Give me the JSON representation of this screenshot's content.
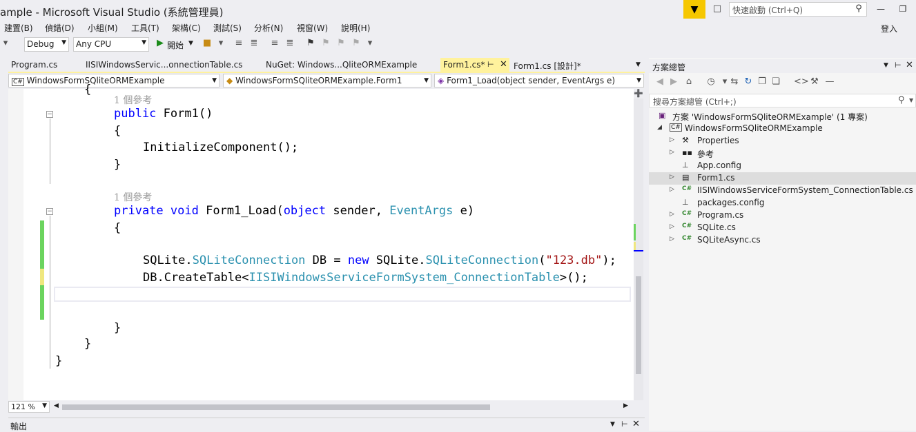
{
  "window": {
    "title": "ample - Microsoft Visual Studio (系統管理員)",
    "quick_launch_placeholder": "快速啟動 (Ctrl+Q)",
    "sign_in": "登入"
  },
  "menu": [
    "建置(B)",
    "偵錯(D)",
    "小組(M)",
    "工具(T)",
    "架構(C)",
    "測試(S)",
    "分析(N)",
    "視窗(W)",
    "說明(H)"
  ],
  "toolbar": {
    "config": "Debug",
    "platform": "Any CPU",
    "start_label": "開始"
  },
  "tabs": [
    {
      "label": "Program.cs"
    },
    {
      "label": "IISIWindowsServic...onnectionTable.cs"
    },
    {
      "label": "NuGet: Windows...QliteORMExample"
    },
    {
      "label": "Form1.cs*"
    },
    {
      "label": "Form1.cs [設計]*"
    }
  ],
  "navbar": {
    "project": "WindowsFormSQliteORMExample",
    "class": "WindowsFormSQliteORMExample.Form1",
    "member": "Form1_Load(object sender, EventArgs e)"
  },
  "code": {
    "brace_top": "{",
    "lens1": "1 個參考",
    "l1_kw": "public",
    "l1_rest": " Form1()",
    "l2": "{",
    "l3": "InitializeComponent();",
    "l4": "}",
    "lens2": "1 個參考",
    "l5_kw1": "private",
    "l5_kw2": "void",
    "l5_name": " Form1_Load(",
    "l5_kw3": "object",
    "l5_mid": " sender, ",
    "l5_ty": "EventArgs",
    "l5_end": " e)",
    "l6": "{",
    "l7_a": "SQLite.",
    "l7_ty1": "SQLiteConnection",
    "l7_b": " DB = ",
    "l7_kw": "new",
    "l7_c": " SQLite.",
    "l7_ty2": "SQLiteConnection",
    "l7_d": "(",
    "l7_str": "\"123.db\"",
    "l7_e": ");",
    "l8_a": "DB.CreateTable<",
    "l8_ty": "IISIWindowsServiceFormSystem_ConnectionTable",
    "l8_b": ">();",
    "l9": "}",
    "l10": "}",
    "l11": "}"
  },
  "zoom": "121 %",
  "output_title": "輸出",
  "solution_explorer": {
    "title": "方案總管",
    "search_placeholder": "搜尋方案總管 (Ctrl+;)",
    "items": [
      {
        "label": "方案 'WindowsFormSQliteORMExample' (1 專案)",
        "icon": "solution-icon"
      },
      {
        "label": "WindowsFormSQliteORMExample",
        "icon": "csharp-project-icon"
      },
      {
        "label": "Properties",
        "icon": "wrench-icon"
      },
      {
        "label": "參考",
        "icon": "references-icon"
      },
      {
        "label": "App.config",
        "icon": "config-icon"
      },
      {
        "label": "Form1.cs",
        "icon": "form-icon"
      },
      {
        "label": "IISIWindowsServiceFormSystem_ConnectionTable.cs",
        "icon": "csharp-file-icon"
      },
      {
        "label": "packages.config",
        "icon": "config-icon"
      },
      {
        "label": "Program.cs",
        "icon": "csharp-file-icon"
      },
      {
        "label": "SQLite.cs",
        "icon": "csharp-file-icon"
      },
      {
        "label": "SQLiteAsync.cs",
        "icon": "csharp-file-icon"
      }
    ]
  },
  "colors": {
    "accent_yellow": "#fff29d",
    "keyword": "#0000ff",
    "type": "#2b91af",
    "string": "#a31515",
    "change_green": "#6bd45e",
    "change_yellow": "#efe77e"
  }
}
